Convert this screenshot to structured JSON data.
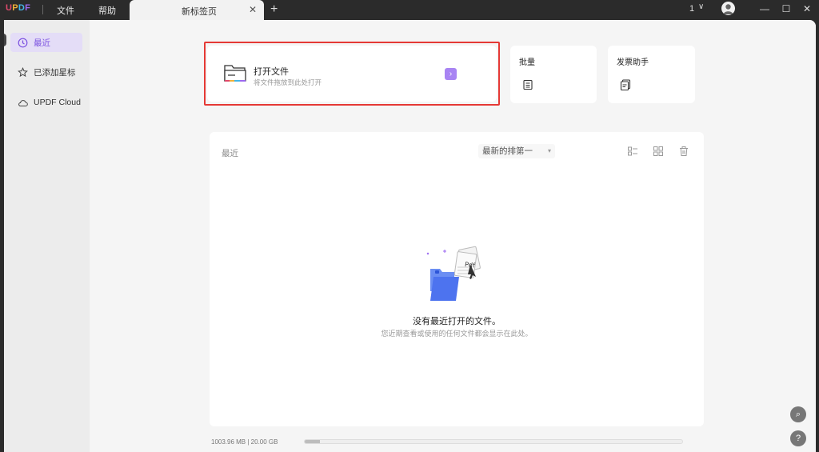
{
  "titlebar": {
    "menu": [
      "文件",
      "帮助"
    ],
    "tab_label": "新标签页",
    "tab_close": "✕",
    "tab_add": "+",
    "tab_count": "1",
    "tab_count_chevron": "∨",
    "window_buttons": {
      "minimize": "—",
      "maximize": "☐",
      "close": "✕"
    }
  },
  "sidebar": {
    "items": [
      {
        "label": "最近",
        "icon": "clock-icon",
        "active": true
      },
      {
        "label": "已添加星标",
        "icon": "star-icon",
        "active": false
      },
      {
        "label": "UPDF Cloud",
        "icon": "cloud-icon",
        "active": false
      }
    ]
  },
  "open_file": {
    "title": "打开文件",
    "subtitle": "将文件拖放到此处打开",
    "arrow": "›"
  },
  "quick_cards": [
    {
      "title": "批量",
      "icon": "batch-doc-icon"
    },
    {
      "title": "发票助手",
      "icon": "invoice-icon"
    }
  ],
  "recent": {
    "title": "最近",
    "sort_label": "最新的排第一",
    "sort_chevron": "▾",
    "empty_title": "没有最近打开的文件。",
    "empty_sub": "您近期查看或使用的任何文件都会显示在此处。"
  },
  "storage": {
    "text": "1003.96 MB | 20.00 GB",
    "used_fraction": 0.04
  },
  "float_buttons": {
    "search": "⌕",
    "help": "?"
  },
  "colors": {
    "accent": "#7a4fe0",
    "highlight": "#e53935",
    "arrow_bg": "#a884f3"
  }
}
